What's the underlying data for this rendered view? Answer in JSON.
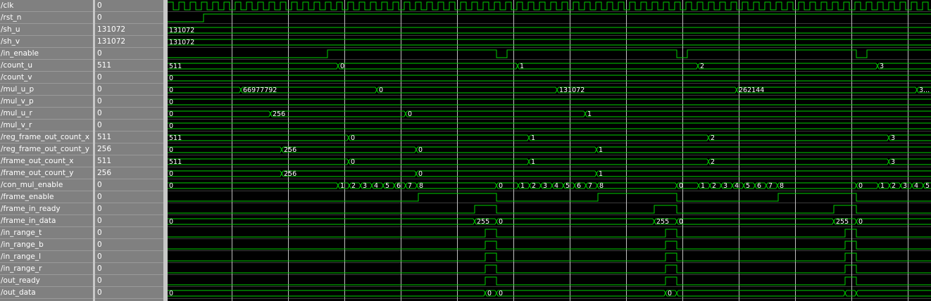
{
  "signals": [
    {
      "name": "/clk",
      "value": "0"
    },
    {
      "name": "/rst_n",
      "value": "0"
    },
    {
      "name": "/sh_u",
      "value": "131072"
    },
    {
      "name": "/sh_v",
      "value": "131072"
    },
    {
      "name": "/in_enable",
      "value": "0"
    },
    {
      "name": "/count_u",
      "value": "511"
    },
    {
      "name": "/count_v",
      "value": "0"
    },
    {
      "name": "/mul_u_p",
      "value": "0"
    },
    {
      "name": "/mul_v_p",
      "value": "0"
    },
    {
      "name": "/mul_u_r",
      "value": "0"
    },
    {
      "name": "/mul_v_r",
      "value": "0"
    },
    {
      "name": "/reg_frame_out_count_x",
      "value": "511"
    },
    {
      "name": "/reg_frame_out_count_y",
      "value": "256"
    },
    {
      "name": "/frame_out_count_x",
      "value": "511"
    },
    {
      "name": "/frame_out_count_y",
      "value": "256"
    },
    {
      "name": "/con_mul_enable",
      "value": "0"
    },
    {
      "name": "/frame_enable",
      "value": "0"
    },
    {
      "name": "/frame_in_ready",
      "value": "0"
    },
    {
      "name": "/frame_in_data",
      "value": "0"
    },
    {
      "name": "/in_range_t",
      "value": "0"
    },
    {
      "name": "/in_range_b",
      "value": "0"
    },
    {
      "name": "/in_range_l",
      "value": "0"
    },
    {
      "name": "/in_range_r",
      "value": "0"
    },
    {
      "name": "/out_ready",
      "value": "0"
    },
    {
      "name": "/out_data",
      "value": "0"
    }
  ],
  "waves": {
    "sh_u": [
      "131072"
    ],
    "sh_v": [
      "131072"
    ],
    "count_u": [
      "511",
      "0",
      "1",
      "2",
      "3"
    ],
    "count_v": [
      "0"
    ],
    "mul_u_p": [
      "0",
      "66977792",
      "0",
      "131072",
      "262144",
      "3..."
    ],
    "mul_v_p": [
      "0"
    ],
    "mul_u_r": [
      "0",
      "256",
      "0",
      "1"
    ],
    "mul_v_r": [
      "0"
    ],
    "reg_frame_out_count_x": [
      "511",
      "0",
      "1",
      "2",
      "3"
    ],
    "reg_frame_out_count_y": [
      "0",
      "256",
      "0",
      "1"
    ],
    "frame_out_count_x": [
      "511",
      "0",
      "1",
      "2",
      "3"
    ],
    "frame_out_count_y": [
      "0",
      "256",
      "0",
      "1"
    ],
    "con_mul_enable": [
      "0",
      "1",
      "2",
      "3",
      "4",
      "5",
      "6",
      "7",
      "8",
      "0",
      "1",
      "2",
      "3",
      "4",
      "5",
      "6",
      "7",
      "8",
      "0",
      "1",
      "2",
      "3",
      "4",
      "5",
      "6",
      "7",
      "8",
      "0",
      "1",
      "2",
      "3",
      "4",
      "5"
    ],
    "frame_in_data": [
      "0",
      "255",
      "0",
      "255",
      "0",
      "255",
      "0"
    ],
    "out_data": [
      "0",
      "0",
      "0",
      "0"
    ]
  },
  "colors": {
    "wave": "#00d000",
    "grid": "#c0c0c0",
    "panel": "#808080",
    "divider": "#c8c8c8",
    "background": "#000000"
  }
}
